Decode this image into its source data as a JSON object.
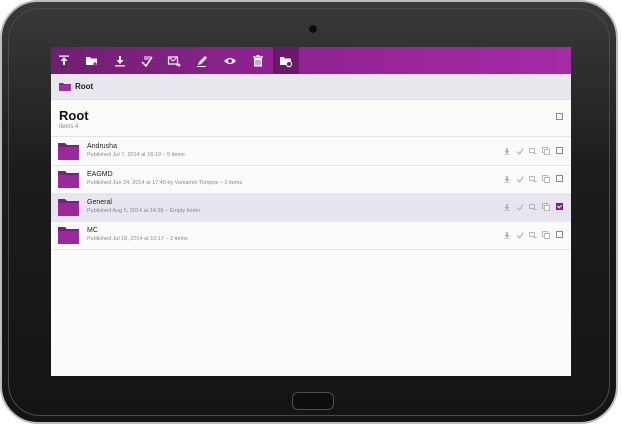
{
  "toolbar": {
    "tools": [
      {
        "name": "upload-icon",
        "active": false
      },
      {
        "name": "new-folder-icon",
        "active": false
      },
      {
        "name": "download-icon",
        "active": false
      },
      {
        "name": "share-icon",
        "active": false
      },
      {
        "name": "send-icon",
        "active": false
      },
      {
        "name": "edit-icon",
        "active": false
      },
      {
        "name": "view-icon",
        "active": false
      },
      {
        "name": "delete-icon",
        "active": false
      },
      {
        "name": "folder-settings-icon",
        "active": true
      }
    ],
    "accent": "#8e2290"
  },
  "breadcrumb": {
    "label": "Root"
  },
  "root": {
    "title": "Root",
    "count": "items 4"
  },
  "items": [
    {
      "name": "Andrusha",
      "meta": "Published Jul 7, 2014 at 16:19 – 5 items",
      "selected": false,
      "checked": false
    },
    {
      "name": "EAGMD",
      "meta": "Published Jun 24, 2014 at 17:45 by Veniamin Toropov – 2 items",
      "selected": false,
      "checked": false
    },
    {
      "name": "General",
      "meta": "Published Aug 5, 2014 at 14:38 – Empty folder",
      "selected": true,
      "checked": true
    },
    {
      "name": "MC",
      "meta": "Published Jul 18, 2014 at 10:17 – 2 items",
      "selected": false,
      "checked": false
    }
  ],
  "row_actions": [
    "download-icon",
    "share-icon",
    "move-icon",
    "copy-icon"
  ]
}
